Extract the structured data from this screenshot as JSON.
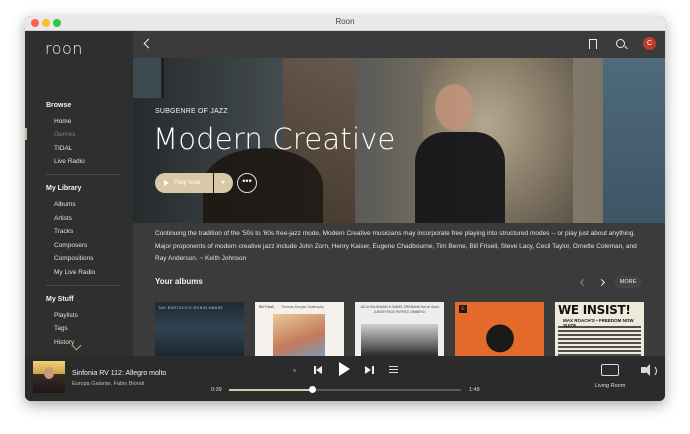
{
  "window": {
    "title": "Roon"
  },
  "sidebar": {
    "logo": "roon",
    "browse": {
      "title": "Browse",
      "items": [
        {
          "label": "Home",
          "dim": false
        },
        {
          "label": "Genres",
          "dim": true
        },
        {
          "label": "TIDAL",
          "dim": false
        },
        {
          "label": "Live Radio",
          "dim": false
        }
      ]
    },
    "library": {
      "title": "My Library",
      "items": [
        "Albums",
        "Artists",
        "Tracks",
        "Composers",
        "Compositions",
        "My Live Radio"
      ]
    },
    "stuff": {
      "title": "My Stuff",
      "items": [
        "Playlists",
        "Tags",
        "History"
      ]
    }
  },
  "topbar": {
    "avatar_letter": "C"
  },
  "hero": {
    "subtitle": "SUBGENRE OF JAZZ",
    "title": "Modern Creative",
    "play_label": "Play now",
    "more_label": "•••"
  },
  "description": "Continuing the tradition of the '50s to '60s free-jazz mode, Modern Creative musicians may incorporate free playing into structured modes -- or play just about anything. Major proponents of modern creative jazz include John Zorn, Henry Kaiser, Eugene Chadbourne, Tim Berne, Bill Frisell, Steve Lacy, Cecil Taylor, Ornette Coleman, and Ray Anderson. ~ Keith Johnson",
  "albums": {
    "title": "Your albums",
    "more_label": "MORE",
    "items": [
      {
        "cover_text": "NIK BÄRTSCH'S RONIN AWASE"
      },
      {
        "cover_text_1": "Bill Frisell",
        "cover_text_2": "Thomas Morgan  Epistrophy"
      },
      {
        "cover_text": "JULIA HÜLSMANN & DANIEL ERDMANN  Not on Sand  JUNIOR PAGE  PATRICK ZIMMERLI"
      },
      {
        "cover_text": "E"
      },
      {
        "cover_text_1": "WE INSIST!",
        "cover_text_2": "MAX ROACH'S • FREEDOM NOW SUITE"
      }
    ]
  },
  "player": {
    "track_title": "Sinfonia RV 112: Allegro molto",
    "track_artist": "Europa Galante, Fabio Biondi",
    "time_current": "0:39",
    "time_total": "1:48",
    "progress": 0.36,
    "zone_label": "Living Room"
  },
  "colors": {
    "accent": "#d8c9a6",
    "avatar": "#c0392b",
    "sidebar_bg": "#2f2f2f",
    "main_bg": "#3b3b3b"
  }
}
